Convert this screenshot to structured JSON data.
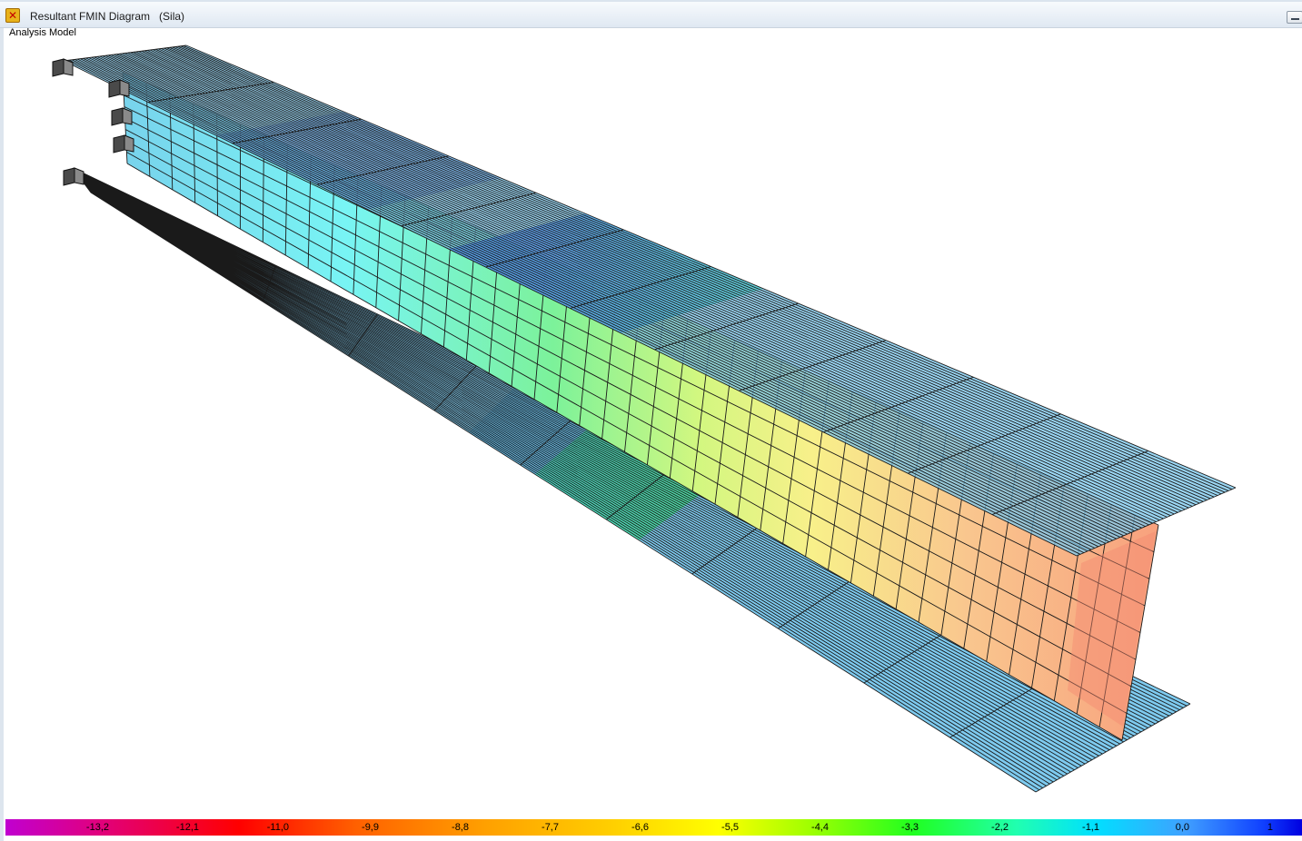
{
  "window": {
    "title": "Resultant FMIN Diagram   (Sila)",
    "model_label": "Analysis Model"
  },
  "icons": {
    "app": "app-logo-icon",
    "restore": "restore-window-icon"
  },
  "colors": {
    "title_bg": "#dfe8f2",
    "mesh_line": "#1a1a1a",
    "flange_base": "#7ecbf0"
  },
  "legend": {
    "ticks": [
      "-13,2",
      "-12,1",
      "-11,0",
      "-9,9",
      "-8,8",
      "-7,7",
      "-6,6",
      "-5,5",
      "-4,4",
      "-3,3",
      "-2,2",
      "-1,1",
      "0,0",
      "1"
    ],
    "min": -13.2,
    "max": 1.0
  }
}
